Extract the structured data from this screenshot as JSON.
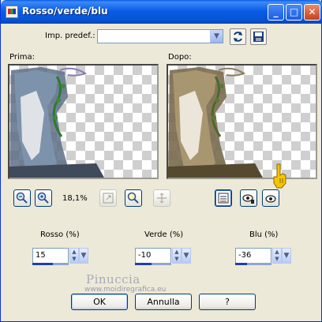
{
  "window": {
    "title": "Rosso/verde/blu",
    "controls": [
      "minimize-icon",
      "maximize-icon",
      "close-icon"
    ]
  },
  "preset": {
    "label": "Imp. predef.:",
    "value": "",
    "reset_icon": "reset-icon",
    "save_icon": "save-icon"
  },
  "previews": {
    "before_label": "Prima:",
    "after_label": "Dopo:"
  },
  "zoom": {
    "value": "18,1%",
    "zoom_out_icon": "zoom-out-icon",
    "zoom_in_icon": "zoom-in-icon",
    "fit_icon": "fit-icon",
    "zoom_100_icon": "zoom-100-icon",
    "pan_icon": "pan-icon"
  },
  "preview_modes": [
    "split-view-icon",
    "proof-icon",
    "auto-proof-icon"
  ],
  "channels": [
    {
      "label": "Rosso (%)",
      "value": "15",
      "level": 0.575
    },
    {
      "label": "Verde (%)",
      "value": "-10",
      "level": 0.45
    },
    {
      "label": "Blu (%)",
      "value": "-36",
      "level": 0.32
    }
  ],
  "buttons": {
    "ok": "OK",
    "cancel": "Annulla",
    "help": "?"
  },
  "watermark": {
    "name": "Pinuccia",
    "url": "www.moidiregrafica.eu"
  }
}
